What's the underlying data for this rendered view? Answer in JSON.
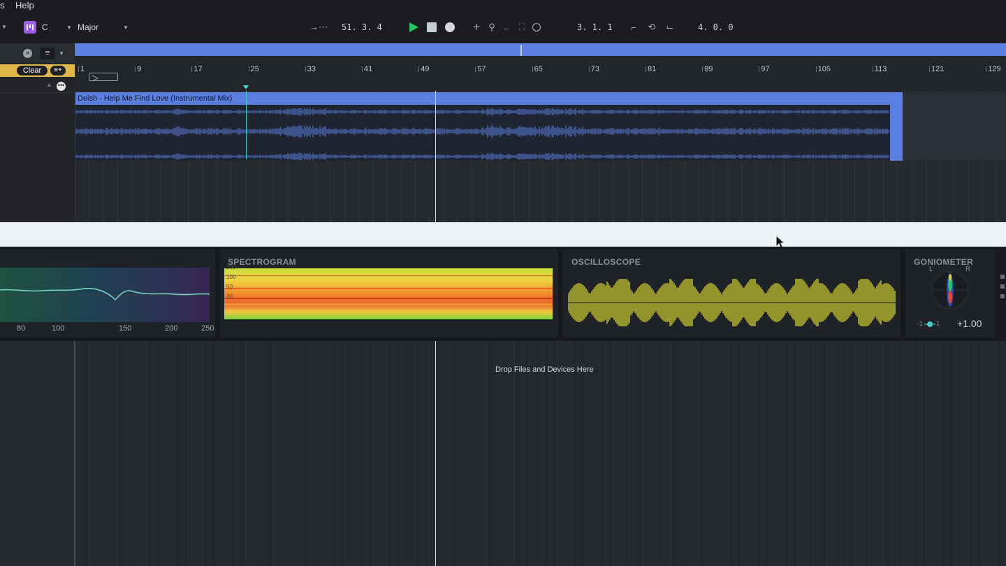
{
  "menubar": {
    "items": [
      "s",
      "Help"
    ]
  },
  "toolbar": {
    "key": "C",
    "scale": "Major",
    "position": "51.  3.  4",
    "loop_start": "3.  1.  1",
    "loop_length": "4.  0.  0",
    "play_color": "#22c55e"
  },
  "left_panel": {
    "clear_label": "Clear"
  },
  "ruler": {
    "bars": [
      "1",
      "9",
      "17",
      "25",
      "33",
      "41",
      "49",
      "57",
      "65",
      "73",
      "81",
      "89",
      "97",
      "105",
      "113",
      "121",
      "129"
    ]
  },
  "clip": {
    "title": "Deish - Help Me Find Love (Instrumental Mix)",
    "color": "#5b7fe0"
  },
  "devices": {
    "spectrogram_title": "SPECTROGRAM",
    "spectrogram_scale": [
      "200",
      "100",
      "50",
      "20"
    ],
    "oscilloscope_title": "OSCILLOSCOPE",
    "goniometer_title": "GONIOMETER",
    "gonio_l": "L",
    "gonio_r": "R",
    "gonio_min": "-1",
    "gonio_max": "1",
    "gonio_value": "+1.00",
    "eq_axis": [
      "80",
      "100",
      "150",
      "200",
      "250"
    ]
  },
  "drop_zone": {
    "text": "Drop Files and Devices Here"
  }
}
